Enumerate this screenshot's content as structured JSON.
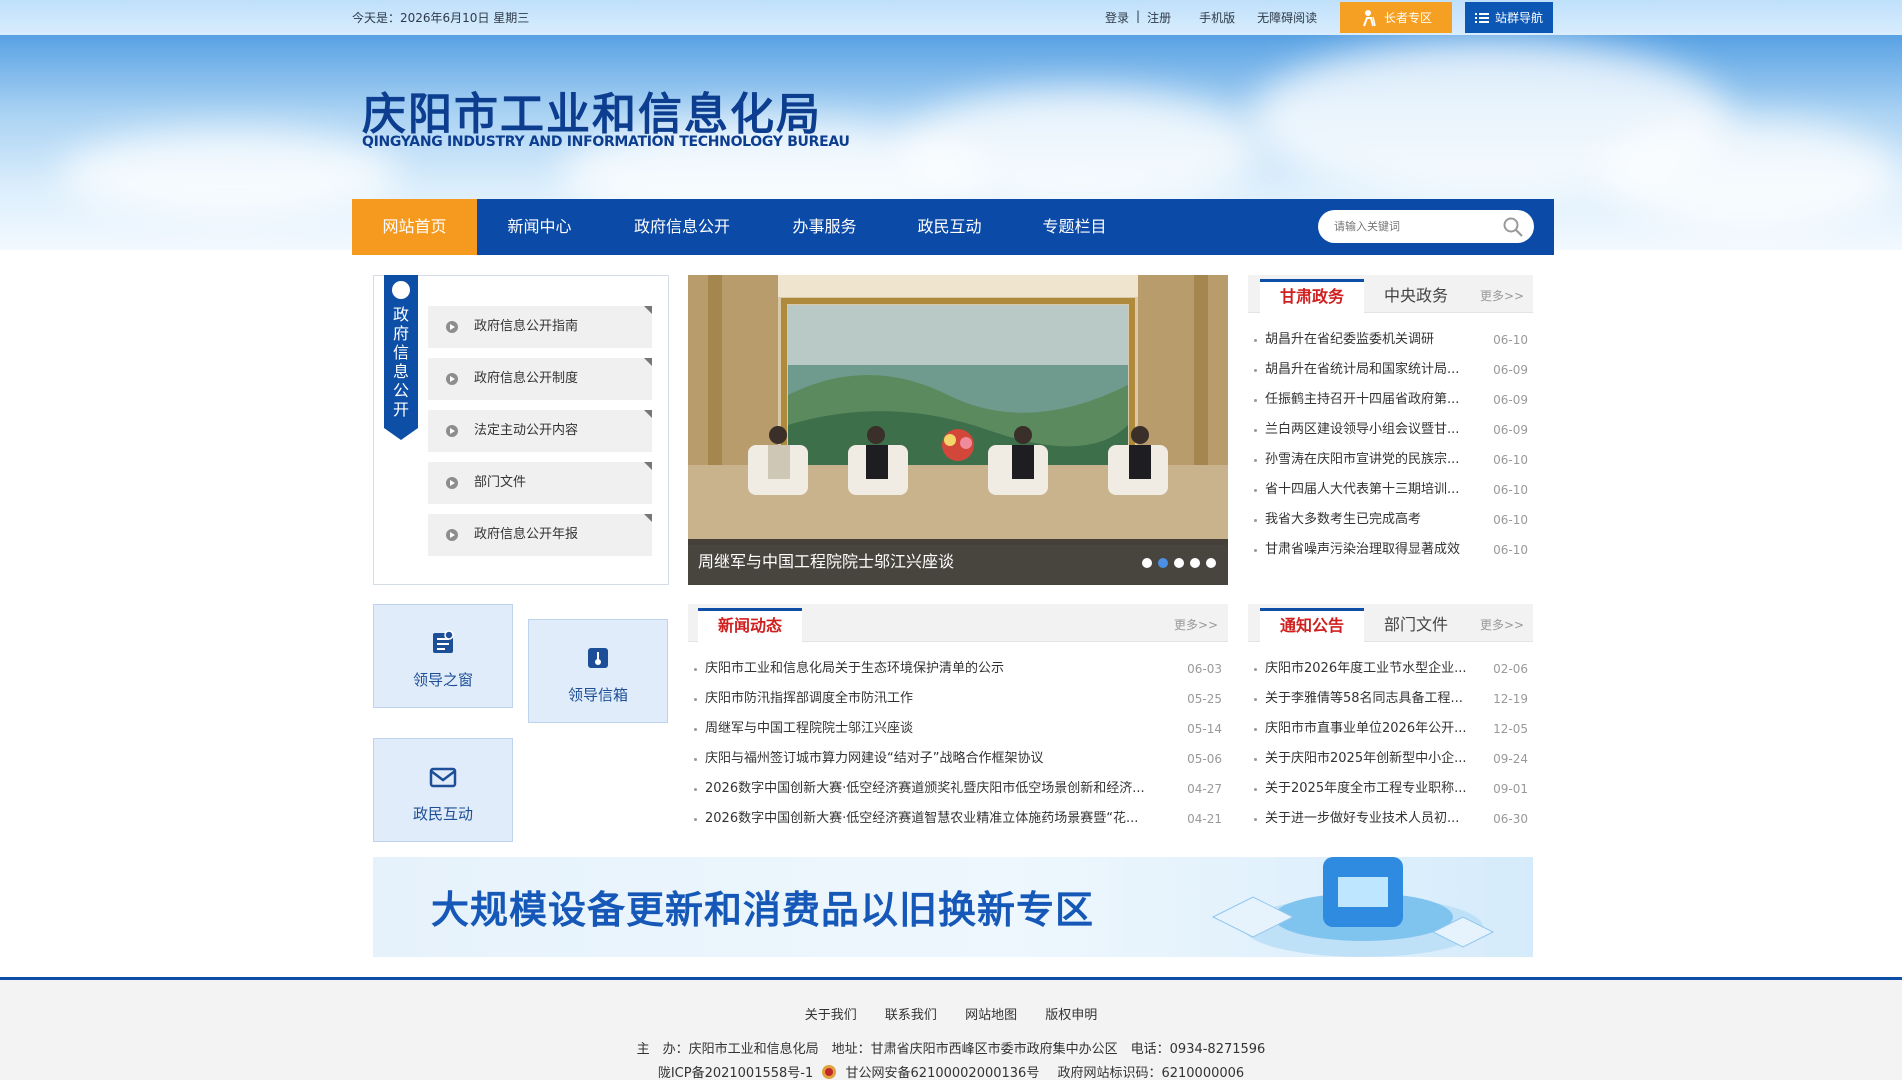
{
  "topbar": {
    "date": "今天是：2026年6月10日 星期三",
    "login": "登录",
    "sep": "|",
    "register": "注册",
    "mobile": "手机版",
    "accessible": "无障碍阅读",
    "elder": "长者专区",
    "sitenav": "站群导航"
  },
  "header": {
    "title_cn": "庆阳市工业和信息化局",
    "title_en": "QINGYANG INDUSTRY AND INFORMATION TECHNOLOGY BUREAU"
  },
  "nav": {
    "items": [
      "网站首页",
      "新闻中心",
      "政府信息公开",
      "办事服务",
      "政民互动",
      "专题栏目"
    ],
    "search_placeholder": "请输入关键词"
  },
  "gov_info": {
    "ribbon": "政府信息公开",
    "items": [
      "政府信息公开指南",
      "政府信息公开制度",
      "法定主动公开内容",
      "部门文件",
      "政府信息公开年报"
    ]
  },
  "quick": {
    "leader_window": "领导之窗",
    "leader_mailbox": "领导信箱",
    "interaction": "政民互动"
  },
  "slider": {
    "caption": "周继军与中国工程院院士邬江兴座谈",
    "dot_count": 5,
    "active_dot": 1
  },
  "gansu": {
    "tabs": [
      "甘肃政务",
      "中央政务"
    ],
    "more": "更多>>",
    "items": [
      {
        "title": "胡昌升在省纪委监委机关调研",
        "date": "06-10"
      },
      {
        "title": "胡昌升在省统计局和国家统计局...",
        "date": "06-09"
      },
      {
        "title": "任振鹤主持召开十四届省政府第...",
        "date": "06-09"
      },
      {
        "title": "兰白两区建设领导小组会议暨甘...",
        "date": "06-09"
      },
      {
        "title": "孙雪涛在庆阳市宣讲党的民族宗...",
        "date": "06-10"
      },
      {
        "title": "省十四届人大代表第十三期培训...",
        "date": "06-10"
      },
      {
        "title": "我省大多数考生已完成高考",
        "date": "06-10"
      },
      {
        "title": "甘肃省噪声污染治理取得显著成效",
        "date": "06-10"
      }
    ]
  },
  "news": {
    "tab": "新闻动态",
    "more": "更多>>",
    "items": [
      {
        "title": "庆阳市工业和信息化局关于生态环境保护清单的公示",
        "date": "06-03"
      },
      {
        "title": "庆阳市防汛指挥部调度全市防汛工作",
        "date": "05-25"
      },
      {
        "title": "周继军与中国工程院院士邬江兴座谈",
        "date": "05-14"
      },
      {
        "title": "庆阳与福州签订城市算力网建设“结对子”战略合作框架协议",
        "date": "05-06"
      },
      {
        "title": "2026数字中国创新大赛·低空经济赛道颁奖礼暨庆阳市低空场景创新和经济...",
        "date": "04-27"
      },
      {
        "title": "2026数字中国创新大赛·低空经济赛道智慧农业精准立体施药场景赛暨“花...",
        "date": "04-21"
      }
    ]
  },
  "notice": {
    "tabs": [
      "通知公告",
      "部门文件"
    ],
    "more": "更多>>",
    "items": [
      {
        "title": "庆阳市2026年度工业节水型企业...",
        "date": "02-06"
      },
      {
        "title": "关于李雅倩等58名同志具备工程...",
        "date": "12-19"
      },
      {
        "title": "庆阳市市直事业单位2026年公开...",
        "date": "12-05"
      },
      {
        "title": "关于庆阳市2025年创新型中小企...",
        "date": "09-24"
      },
      {
        "title": "关于2025年度全市工程专业职称...",
        "date": "09-01"
      },
      {
        "title": "关于进一步做好专业技术人员初...",
        "date": "06-30"
      }
    ]
  },
  "banner": {
    "title": "大规模设备更新和消费品以旧换新专区"
  },
  "footer": {
    "links": [
      "关于我们",
      "联系我们",
      "网站地图",
      "版权申明"
    ],
    "host": "主　办：庆阳市工业和信息化局　地址：甘肃省庆阳市西峰区市委市政府集中办公区　电话：0934-8271596",
    "icp": "陇ICP备2021001558号-1",
    "police": "甘公网安备62100002000136号",
    "site_id": "政府网站标识码：6210000006"
  },
  "colors": {
    "nav_bg": "#0b4aa6",
    "nav_active": "#f59a1f",
    "title_blue": "#0c3d8f",
    "tab_red": "#d01f1f"
  }
}
